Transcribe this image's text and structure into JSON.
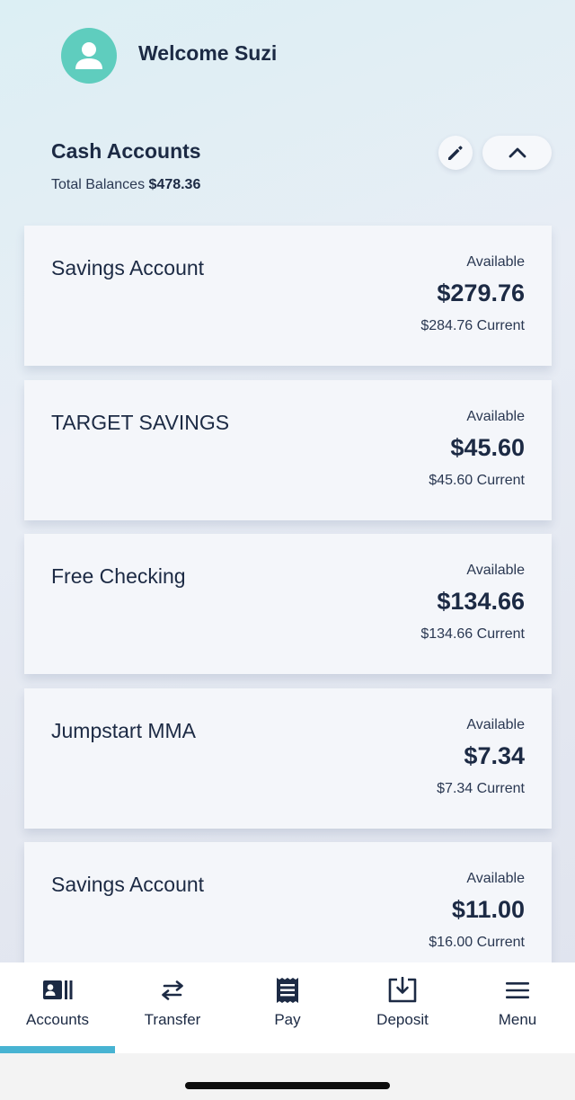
{
  "header": {
    "welcome": "Welcome Suzi"
  },
  "section": {
    "title": "Cash Accounts",
    "total_label": "Total Balances",
    "total_value": "$478.36"
  },
  "accounts": [
    {
      "name": "Savings Account",
      "available_label": "Available",
      "available": "$279.76",
      "current": "$284.76 Current"
    },
    {
      "name": "TARGET SAVINGS",
      "available_label": "Available",
      "available": "$45.60",
      "current": "$45.60 Current"
    },
    {
      "name": "Free Checking",
      "available_label": "Available",
      "available": "$134.66",
      "current": "$134.66 Current"
    },
    {
      "name": "Jumpstart MMA",
      "available_label": "Available",
      "available": "$7.34",
      "current": "$7.34 Current"
    },
    {
      "name": "Savings Account",
      "available_label": "Available",
      "available": "$11.00",
      "current": "$16.00 Current"
    }
  ],
  "tabs": [
    {
      "label": "Accounts",
      "icon": "accounts-icon",
      "active": true
    },
    {
      "label": "Transfer",
      "icon": "transfer-icon",
      "active": false
    },
    {
      "label": "Pay",
      "icon": "pay-icon",
      "active": false
    },
    {
      "label": "Deposit",
      "icon": "deposit-icon",
      "active": false
    },
    {
      "label": "Menu",
      "icon": "menu-icon",
      "active": false
    }
  ],
  "colors": {
    "avatar": "#5fcdbe",
    "active_tab_indicator": "#47b3d2",
    "text": "#1c2a44"
  }
}
